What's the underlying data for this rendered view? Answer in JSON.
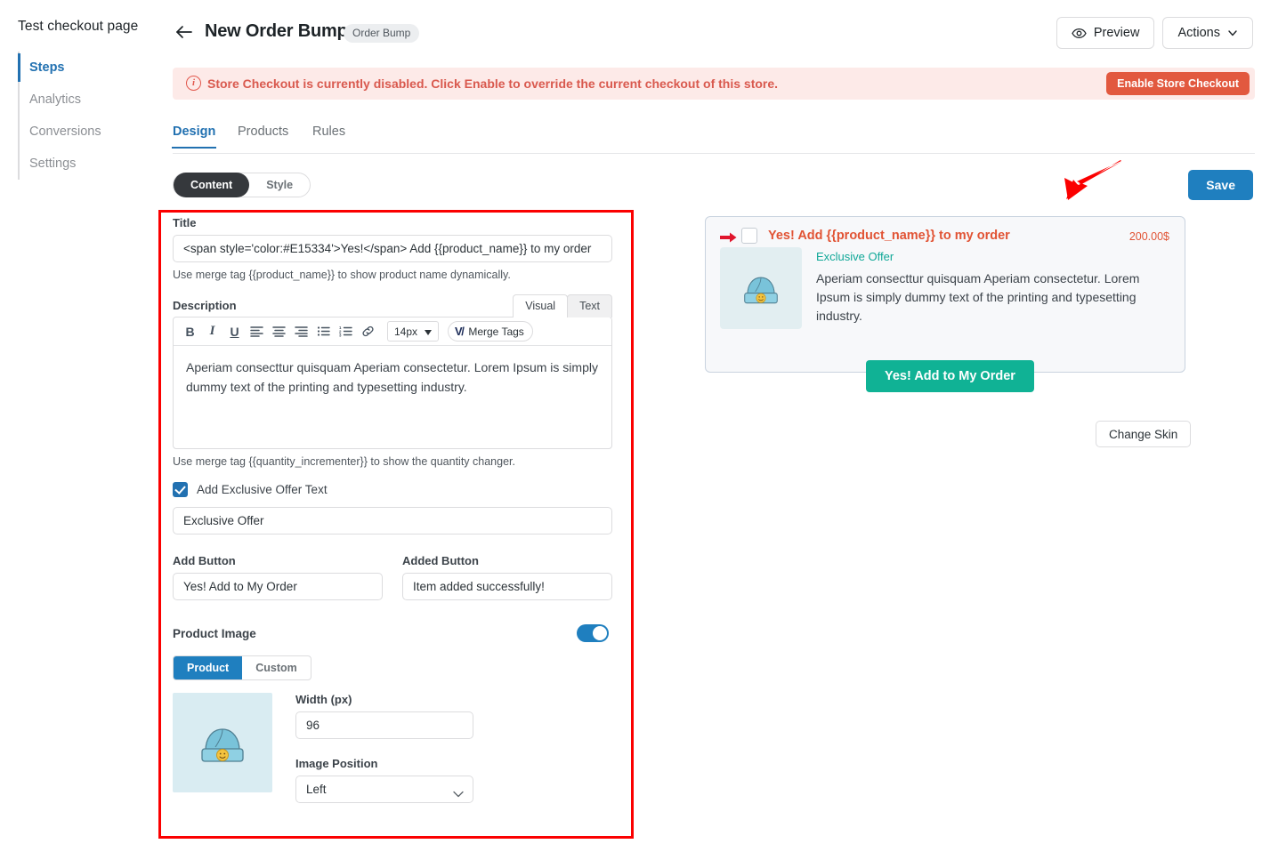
{
  "sidebar": {
    "title": "Test checkout page",
    "items": [
      {
        "label": "Steps",
        "active": true
      },
      {
        "label": "Analytics",
        "active": false
      },
      {
        "label": "Conversions",
        "active": false
      },
      {
        "label": "Settings",
        "active": false
      }
    ]
  },
  "header": {
    "back_icon": "arrow-left-icon",
    "title": "New Order Bump",
    "badge": "Order Bump",
    "preview_label": "Preview",
    "preview_icon": "eye-icon",
    "actions_label": "Actions",
    "actions_icon": "chevron-down-icon"
  },
  "notice": {
    "icon": "info-circle-icon",
    "message": "Store Checkout is currently disabled. Click Enable to override the current checkout of this store.",
    "button_label": "Enable Store Checkout",
    "bg_color": "#fdeae8",
    "text_color": "#d9594e",
    "button_color": "#e2593f"
  },
  "tabs": [
    {
      "label": "Design",
      "active": true
    },
    {
      "label": "Products",
      "active": false
    },
    {
      "label": "Rules",
      "active": false
    }
  ],
  "mode_toggle": [
    {
      "label": "Content",
      "active": true
    },
    {
      "label": "Style",
      "active": false
    }
  ],
  "form": {
    "title_label": "Title",
    "title_value": "<span style='color:#E15334'>Yes!</span> Add {{product_name}} to my order",
    "title_helper": "Use merge tag {{product_name}} to show product name dynamically.",
    "description_label": "Description",
    "editor_tabs": [
      {
        "label": "Visual",
        "active": true
      },
      {
        "label": "Text",
        "active": false
      }
    ],
    "toolbar": {
      "bold": "B",
      "italic": "I",
      "underline": "U",
      "align_left_icon": "align-left-icon",
      "align_center_icon": "align-center-icon",
      "align_right_icon": "align-right-icon",
      "bullet_list_icon": "bullet-list-icon",
      "numbered_list_icon": "numbered-list-icon",
      "link_icon": "link-icon",
      "font_size": "14px",
      "font_size_caret": "caret-down-icon",
      "merge_tags_label": "Merge Tags",
      "merge_tags_icon": "merge-tags-logo-icon"
    },
    "description_value": "Aperiam consecttur quisquam Aperiam consectetur. Lorem Ipsum is simply dummy text of the printing and typesetting industry.",
    "description_helper": "Use merge tag {{quantity_incrementer}} to show the quantity changer.",
    "exclusive_checkbox_label": "Add Exclusive Offer Text",
    "exclusive_checkbox_checked": true,
    "exclusive_value": "Exclusive Offer",
    "add_button_label": "Add Button",
    "add_button_value": "Yes! Add to My Order",
    "added_button_label": "Added Button",
    "added_button_value": "Item added successfully!",
    "product_image_label": "Product Image",
    "product_image_enabled": true,
    "image_source": [
      {
        "label": "Product",
        "active": true
      },
      {
        "label": "Custom",
        "active": false
      }
    ],
    "thumb_icon": "beanie-hat-image",
    "width_label": "Width (px)",
    "width_value": "96",
    "image_position_label": "Image Position",
    "image_position_value": "Left",
    "image_position_caret": "chevron-down-icon"
  },
  "preview": {
    "save_label": "Save",
    "annotation_icon": "red-arrow-annotation",
    "bump": {
      "arrow_icon": "red-arrow-icon",
      "checkbox_checked": false,
      "title": "Yes! Add {{product_name}} to my order",
      "price": "200.00$",
      "thumb_icon": "beanie-hat-image",
      "exclusive_text": "Exclusive Offer",
      "description": "Aperiam consecttur quisquam Aperiam consectetur. Lorem Ipsum is simply dummy text of the printing and typesetting industry.",
      "cta_label": "Yes! Add to My Order",
      "title_color": "#e15334",
      "exclusive_color": "#11a898",
      "cta_color": "#10b295"
    },
    "change_skin_label": "Change Skin"
  }
}
